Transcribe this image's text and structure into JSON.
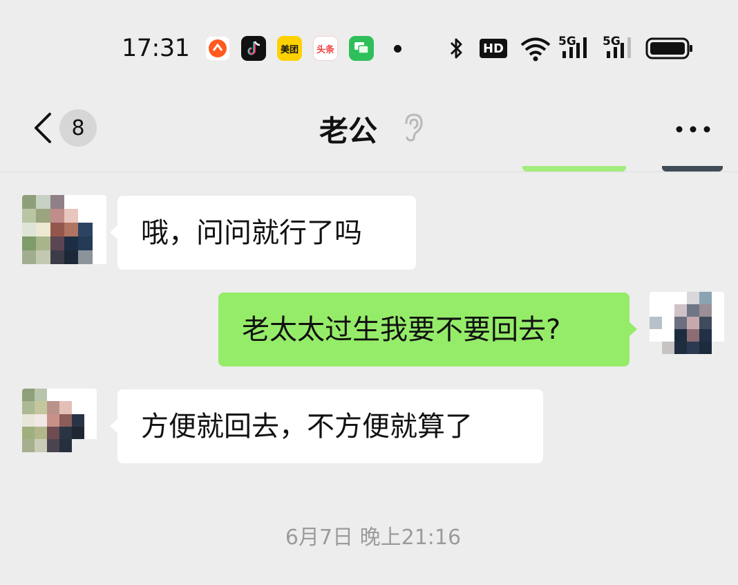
{
  "status_bar": {
    "time": "17:31",
    "apps": [
      {
        "name": "orange-app-icon",
        "label": "",
        "color": "#ff5a1f"
      },
      {
        "name": "douyin-app-icon",
        "label": "",
        "color": "#111111"
      },
      {
        "name": "meituan-app-icon",
        "label": "美团",
        "color": "#ffd100"
      },
      {
        "name": "toutiao-app-icon",
        "label": "头条",
        "color": "#f04142"
      },
      {
        "name": "messages-app-icon",
        "label": "",
        "color": "#2fbf5a"
      }
    ],
    "hd_label": "HD",
    "network_1": "5G",
    "network_2": "5G"
  },
  "nav": {
    "unread_count": "8",
    "title": "老公"
  },
  "messages": [
    {
      "side": "left",
      "text": "哦，问问就行了吗"
    },
    {
      "side": "right",
      "text": "老太太过生我要不要回去?"
    },
    {
      "side": "left",
      "text": "方便就回去，不方便就算了"
    }
  ],
  "timestamp": "6月7日 晚上21:16",
  "colors": {
    "background": "#ededed",
    "bubble_self": "#95ec69",
    "bubble_other": "#ffffff",
    "timestamp_text": "#9b9b9b"
  }
}
